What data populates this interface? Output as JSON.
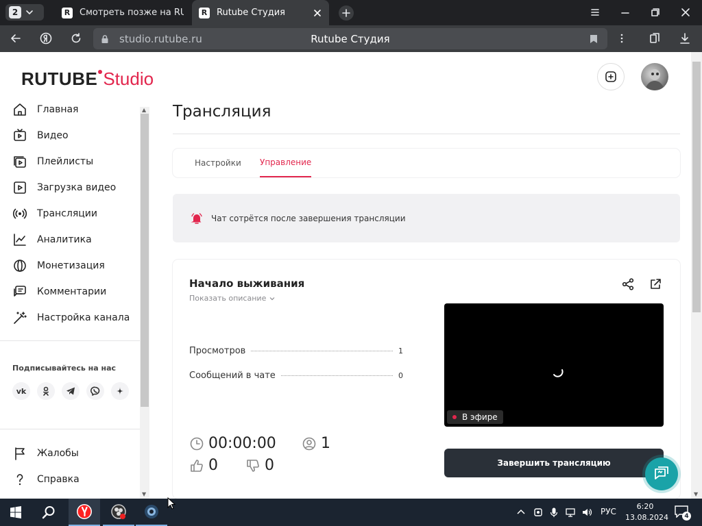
{
  "browser": {
    "tab_count": "2",
    "tabs": [
      {
        "label": "Смотреть позже на RUTUBE"
      },
      {
        "label": "Rutube Студия"
      }
    ],
    "url": "studio.rutube.ru",
    "page_title": "Rutube Студия"
  },
  "logo": {
    "brand": "RUTUBE",
    "product": "Studio",
    "accent_color": "#e2264d"
  },
  "sidebar": {
    "items": [
      {
        "label": "Главная",
        "icon": "home-icon"
      },
      {
        "label": "Видео",
        "icon": "video-icon"
      },
      {
        "label": "Плейлисты",
        "icon": "playlist-icon"
      },
      {
        "label": "Загрузка видео",
        "icon": "upload-icon"
      },
      {
        "label": "Трансляции",
        "icon": "broadcast-icon"
      },
      {
        "label": "Аналитика",
        "icon": "analytics-icon"
      },
      {
        "label": "Монетизация",
        "icon": "monetization-icon"
      },
      {
        "label": "Комментарии",
        "icon": "comments-icon"
      },
      {
        "label": "Настройка канала",
        "icon": "magic-wand-icon"
      }
    ],
    "follow_title": "Подписывайтесь на нас",
    "socials": [
      "vk",
      "ok",
      "telegram",
      "viber",
      "zen"
    ],
    "bottom_items": [
      {
        "label": "Жалобы",
        "icon": "flag-icon"
      },
      {
        "label": "Справка",
        "icon": "help-icon"
      }
    ]
  },
  "main": {
    "title": "Трансляция",
    "tabs": [
      {
        "label": "Настройки",
        "active": false
      },
      {
        "label": "Управление",
        "active": true
      }
    ],
    "notice": "Чат сотрётся после завершения трансляции",
    "stream": {
      "title": "Начало выживания",
      "show_description": "Показать описание",
      "stats": [
        {
          "label": "Просмотров",
          "value": "1"
        },
        {
          "label": "Сообщений в чате",
          "value": "0"
        }
      ],
      "duration": "00:00:00",
      "viewers_now": "1",
      "likes": "0",
      "dislikes": "0",
      "live_badge": "В эфире",
      "end_button": "Завершить трансляцию"
    }
  },
  "taskbar": {
    "lang": "РУС",
    "time": "6:20",
    "date": "13.08.2024",
    "notifications": "4"
  }
}
